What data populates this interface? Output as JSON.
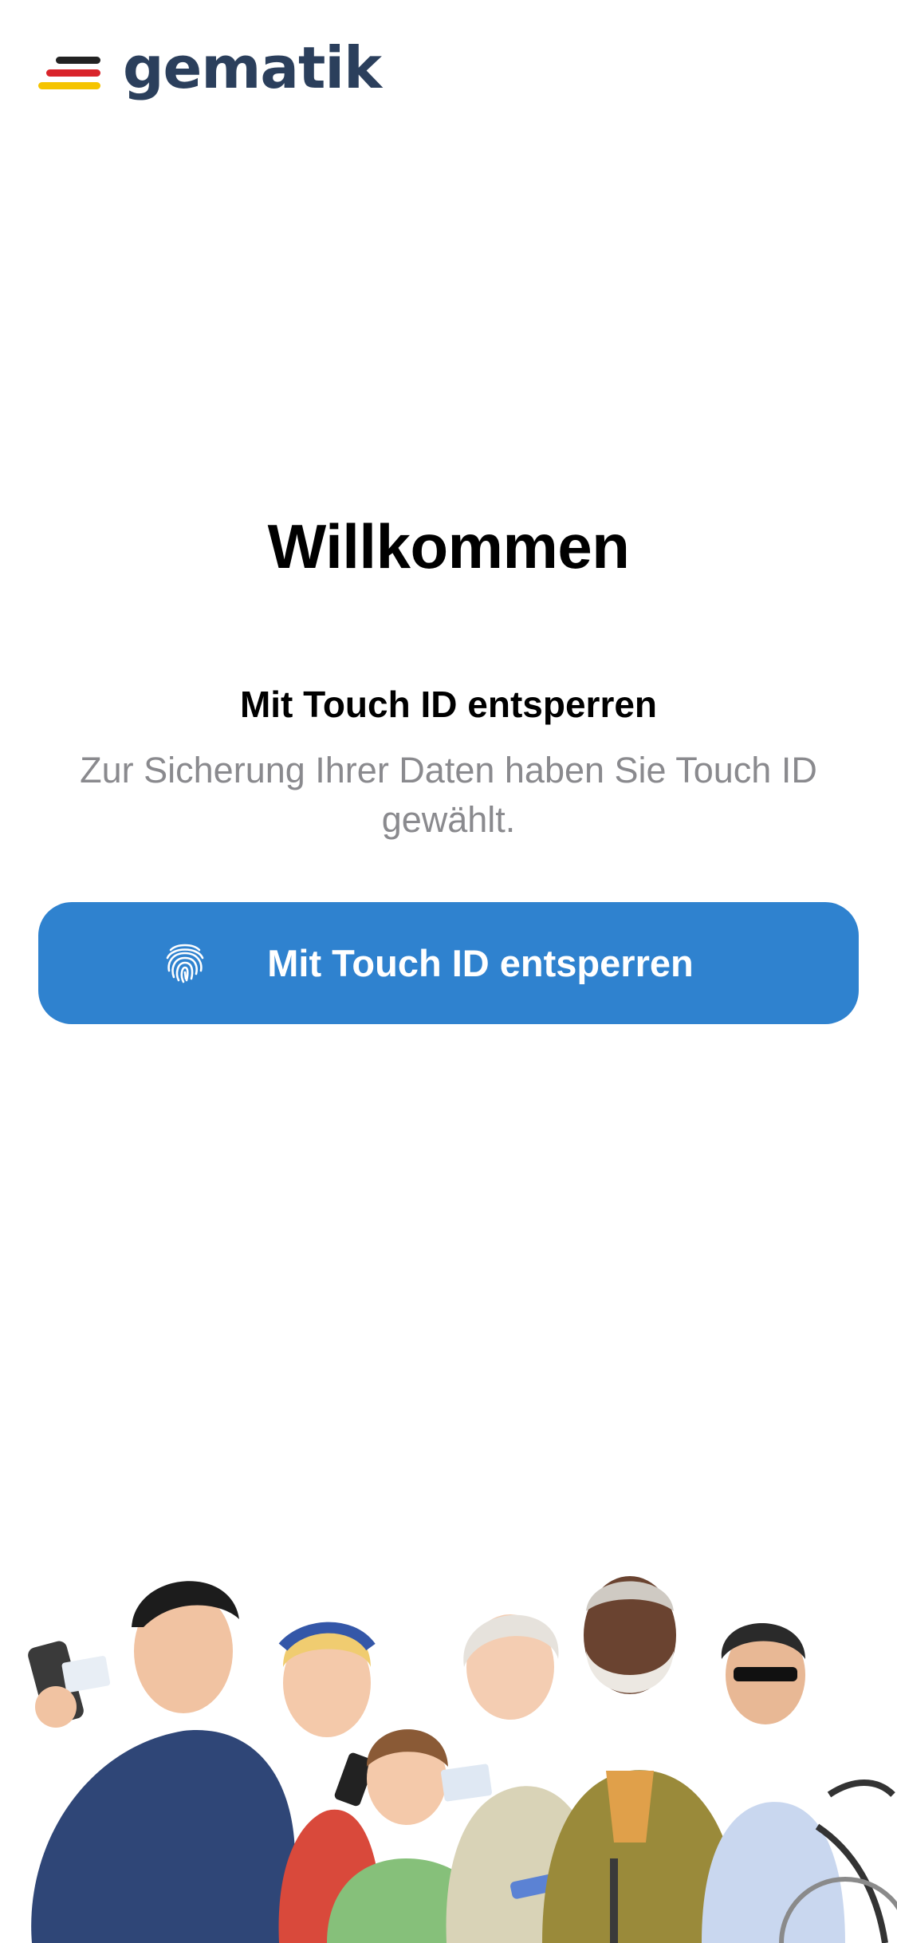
{
  "header": {
    "logo_text": "gematik",
    "logo_colors": [
      "#222222",
      "#d9242b",
      "#f5c400"
    ],
    "logo_text_color": "#2b3f5c"
  },
  "main": {
    "title": "Willkommen",
    "subtitle": "Mit Touch ID entsperren",
    "description": "Zur Sicherung Ihrer Daten haben Sie Touch ID gewählt.",
    "unlock_button": {
      "label": "Mit Touch ID entsperren",
      "icon": "fingerprint-icon",
      "color": "#2f82cf"
    }
  },
  "illustration": {
    "name": "group-of-people-illustration"
  }
}
